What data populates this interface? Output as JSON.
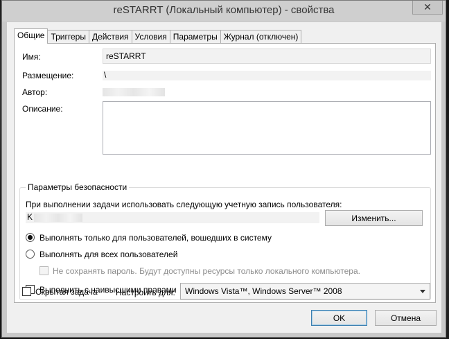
{
  "window": {
    "title": "reSTARRT (Локальный компьютер) - свойства",
    "close_glyph": "✕"
  },
  "tabs": [
    {
      "label": "Общие",
      "active": true
    },
    {
      "label": "Триггеры"
    },
    {
      "label": "Действия"
    },
    {
      "label": "Условия"
    },
    {
      "label": "Параметры"
    },
    {
      "label": "Журнал (отключен)"
    }
  ],
  "general": {
    "name_label": "Имя:",
    "name_value": "reSTARRT",
    "location_label": "Размещение:",
    "location_value": "\\",
    "author_label": "Автор:",
    "description_label": "Описание:"
  },
  "security": {
    "group_title": "Параметры безопасности",
    "account_prompt": "При выполнении задачи использовать следующую учетную запись пользователя:",
    "account_value": "K",
    "change_button": "Изменить...",
    "radio_logged_on": "Выполнять только для пользователей, вошедших в систему",
    "radio_all_users": "Выполнять для всех пользователей",
    "no_store_password": "Не сохранять пароль. Будут доступны ресурсы только локального компьютера.",
    "highest_privileges": "Выполнить с наивысшими правами"
  },
  "footer": {
    "hidden_task": "Скрытая задача",
    "configure_for_label": "Настроить для:",
    "configure_for_value": "Windows Vista™, Windows Server™ 2008",
    "ok_button": "OK",
    "cancel_button": "Отмена"
  }
}
